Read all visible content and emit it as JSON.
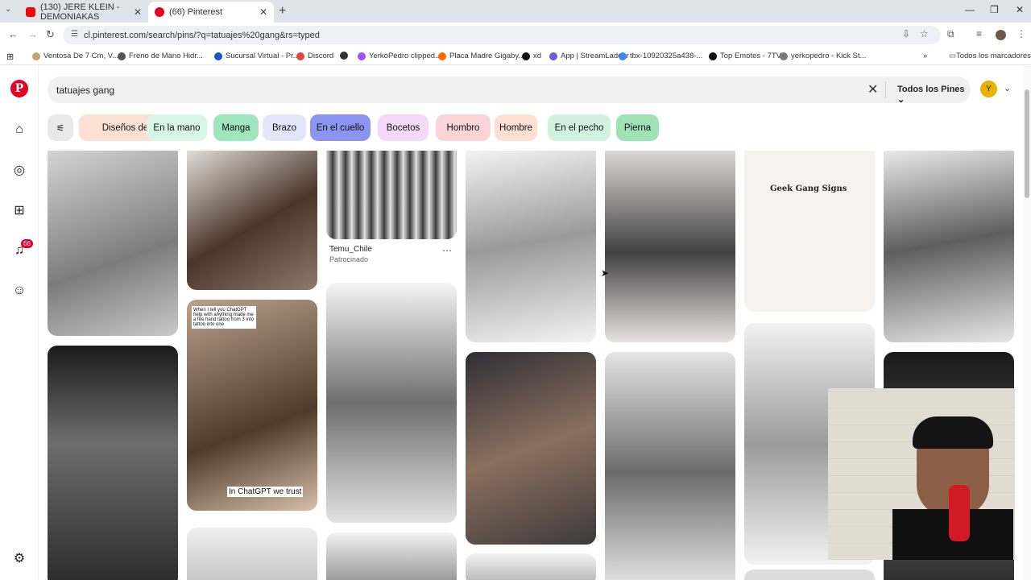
{
  "browser": {
    "tabs": [
      {
        "label": "(130) JERE KLEIN - DEMONIAKAS",
        "favicon_color": "#ff0000"
      },
      {
        "label": "(66) Pinterest",
        "favicon_color": "#e60023"
      }
    ],
    "url": "cl.pinterest.com/search/pins/?q=tatuajes%20gang&rs=typed",
    "bookmarks": [
      {
        "label": "Ventosa De 7 Cm, V...",
        "icon_color": "#c4a36a"
      },
      {
        "label": "Freno de Mano Hidr...",
        "icon_color": "#555555"
      },
      {
        "label": "Sucursal Virtual - Pr...",
        "icon_color": "#1a55c8"
      },
      {
        "label": "Discord",
        "icon_color": "#e3463d"
      },
      {
        "label": "",
        "icon_color": "#333333"
      },
      {
        "label": "YerkoPedro clipped...",
        "icon_color": "#a64dff"
      },
      {
        "label": "Placa Madre Gigaby...",
        "icon_color": "#ff6a00"
      },
      {
        "label": "xd",
        "icon_color": "#111111"
      },
      {
        "label": "App | StreamLadder",
        "icon_color": "#6b5bd6"
      },
      {
        "label": "tbx-10920325a438-...",
        "icon_color": "#4285f4"
      },
      {
        "label": "Top Emotes - 7TV",
        "icon_color": "#111111"
      },
      {
        "label": "yerkopedro - Kick St...",
        "icon_color": "#7a7a7a"
      }
    ],
    "all_bookmarks": "Todos los marcadores"
  },
  "sidebar": {
    "notification_count": "66"
  },
  "search": {
    "query": "tatuajes gang",
    "filter_label": "Todos los Pines",
    "avatar_initial": "Y"
  },
  "chips": [
    {
      "label": "Diseños de",
      "color": "#fde0d4"
    },
    {
      "label": "En la mano",
      "color": "#d9f5e6"
    },
    {
      "label": "Manga",
      "color": "#9fe5bd"
    },
    {
      "label": "Brazo",
      "color": "#e4e4fb"
    },
    {
      "label": "En el cuello",
      "color": "#8b94f0"
    },
    {
      "label": "Bocetos",
      "color": "#f4d8f8"
    },
    {
      "label": "Hombro",
      "color": "#fbd4d8"
    },
    {
      "label": "Hombre",
      "color": "#fde0d2"
    },
    {
      "label": "En el pecho",
      "color": "#d2f2e0"
    },
    {
      "label": "Pierna",
      "color": "#9fe2b6"
    }
  ],
  "sponsored_pin": {
    "name": "Temu_Chile",
    "tag": "Patrocinado"
  },
  "pin_texts": {
    "chatgpt_caption": "In ChatGPT we trust",
    "geek_title": "Geek Gang Signs",
    "chatgpt_top": "When I tell you ChatGPT help with anything made me a fire hand tattoo from 3 into tattoo into one"
  }
}
